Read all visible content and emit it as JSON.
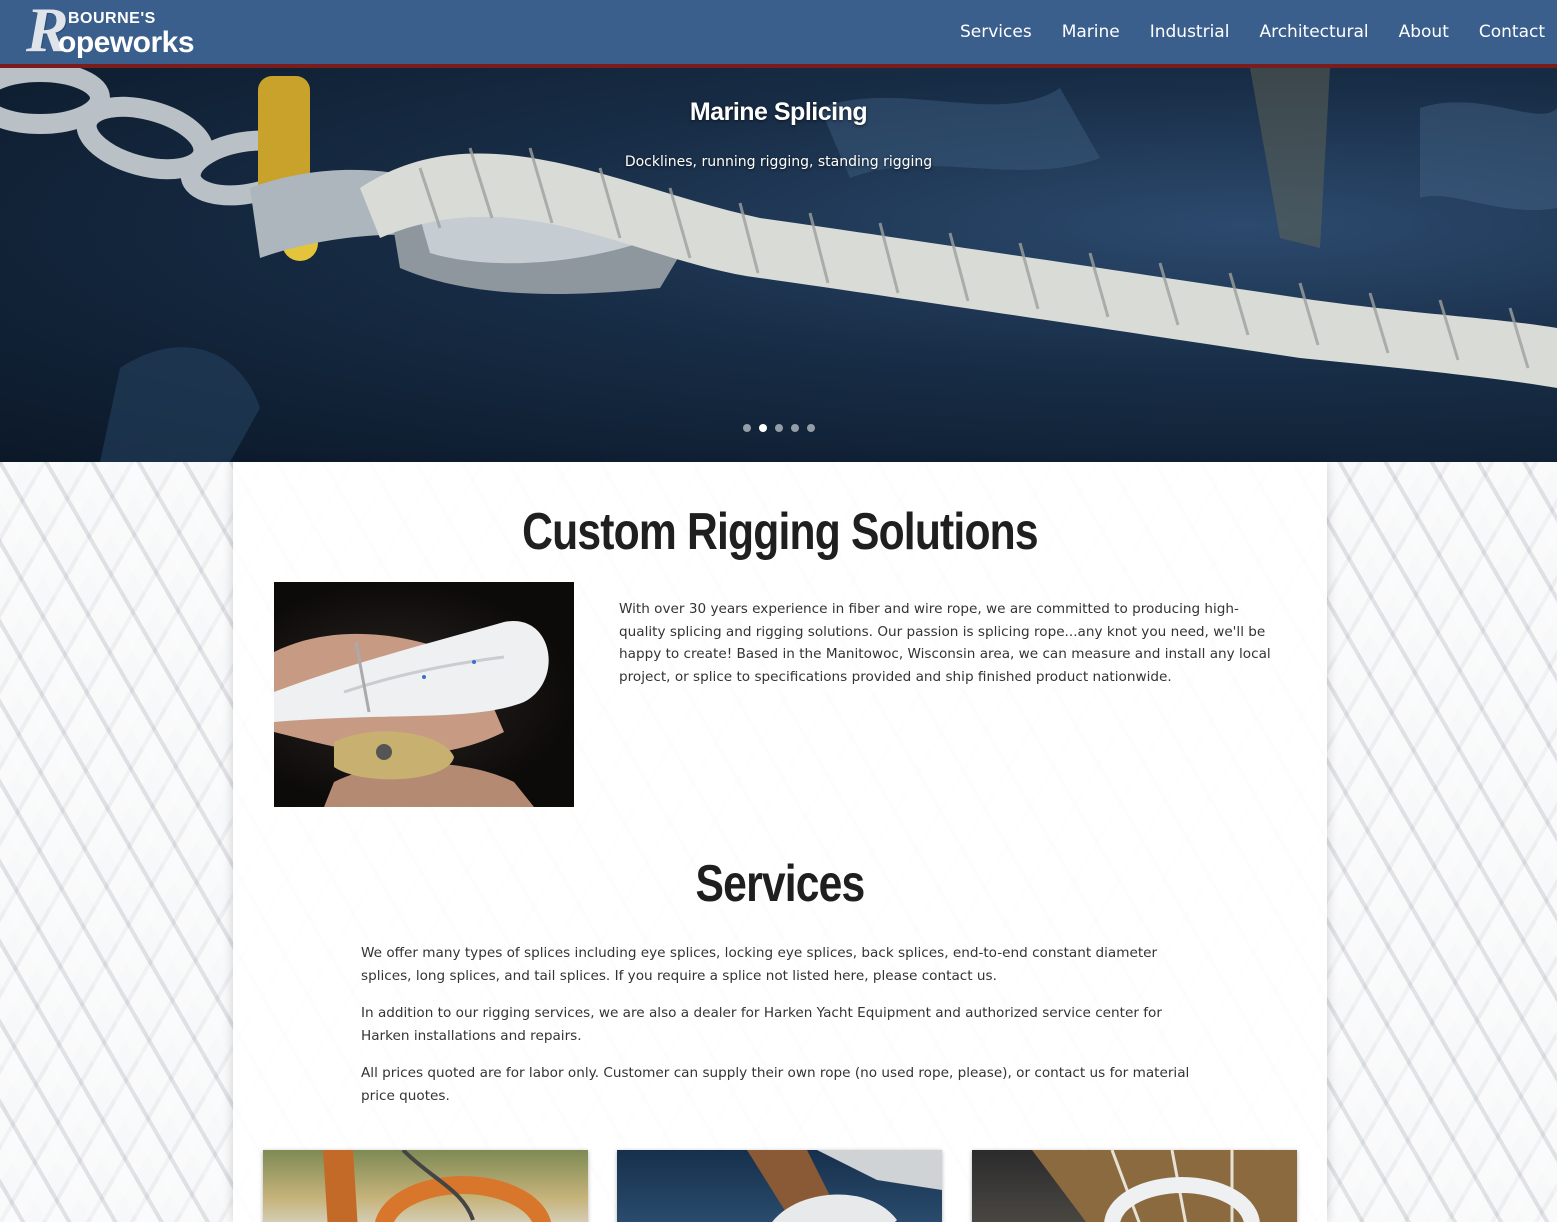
{
  "logo": {
    "top": "BOURNE'S",
    "initial": "R",
    "rest": "opeworks"
  },
  "nav": [
    "Services",
    "Marine",
    "Industrial",
    "Architectural",
    "About",
    "Contact"
  ],
  "hero": {
    "title": "Marine Splicing",
    "subtitle": "Docklines, running rigging, standing rigging",
    "slide_count": 5,
    "active_slide": 2
  },
  "intro": {
    "heading": "Custom Rigging Solutions",
    "body": "With over 30 years experience in fiber and wire rope, we are committed to producing high-quality splicing and rigging solutions. Our passion is splicing rope...any knot you need, we'll be happy to create! Based in the Manitowoc, Wisconsin area, we can measure and install any local project, or splice to specifications provided and ship finished product nationwide."
  },
  "services": {
    "heading": "Services",
    "paragraphs": [
      "We offer many types of splices including eye splices, locking eye splices, back splices, end-to-end constant diameter splices, long splices, and tail splices. If you require a splice not listed here, please contact us.",
      "In addition to our rigging services, we are also a dealer for Harken Yacht Equipment and authorized service center for Harken installations and repairs.",
      "All prices quoted are for labor only. Customer can supply their own rope (no used rope, please), or contact us for material price quotes."
    ]
  },
  "colors": {
    "navbar": "#3a5f8d",
    "navbar_border": "#7a1c1c",
    "heading": "#1f1f1f",
    "body_text": "#333333"
  }
}
